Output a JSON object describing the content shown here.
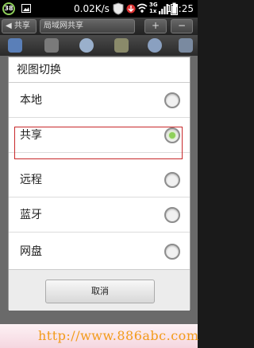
{
  "status_bar": {
    "notification_count": "38",
    "net_speed": "0.02K/s",
    "signal_3g": "3G",
    "signal_1x": "1x",
    "time": "17:25"
  },
  "app_header": {
    "share_button": "◀ 共享",
    "path": "局域网共享",
    "add_button": "+",
    "minus_button": "−"
  },
  "dialog": {
    "title": "视图切换",
    "options": [
      {
        "label": "本地",
        "selected": false
      },
      {
        "label": "共享",
        "selected": true
      },
      {
        "label": "远程",
        "selected": false
      },
      {
        "label": "蓝牙",
        "selected": false
      },
      {
        "label": "网盘",
        "selected": false
      }
    ],
    "cancel_label": "取消"
  },
  "watermark": "http://www.886abc.com",
  "colors": {
    "accent": "#8fd05a",
    "highlight": "#c8292b",
    "watermark": "#f29b1a"
  }
}
